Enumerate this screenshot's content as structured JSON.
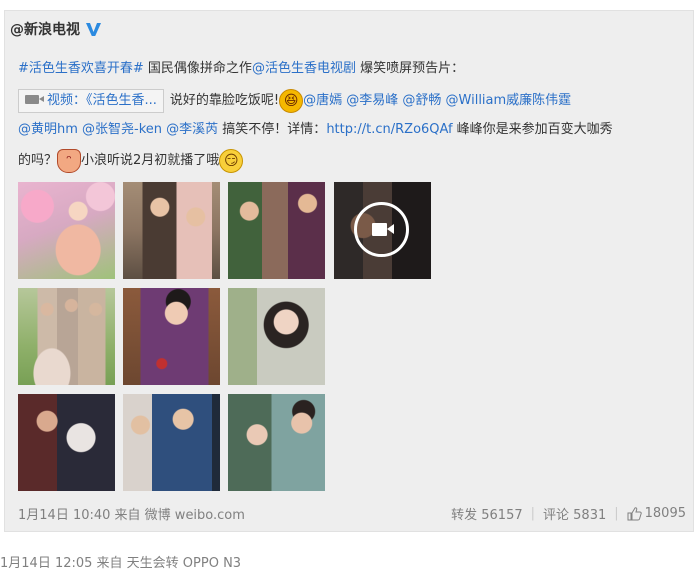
{
  "post": {
    "author": "@新浪电视",
    "verified_icon": "verified-v-icon",
    "hashtag": "#活色生香欢喜开春#",
    "text1": " 国民偶像拼命之作",
    "mention_show": "@活色生香电视剧",
    "text2": " 爆笑喷屏预告片：",
    "video_label": "视频：《活色生香...",
    "text3": "说好的靠脸吃饭呢!",
    "mentions_line2": "@唐嫣 @李易峰 @舒畅 @William威廉陈伟霆",
    "mentions_line3": "@黄明hm @张智尧-ken @李溪芮",
    "text4": " 搞笑不停！详情：",
    "link": "http://t.cn/RZo6QAf",
    "text5": " 峰峰你是来参加百变大咖秀",
    "text6": "的吗？",
    "text7": "小浪听说2月初就播了哦",
    "emoticons": [
      "laughing-face-icon",
      "elf-face-icon",
      "smirk-face-icon"
    ]
  },
  "thumbnails": [
    {
      "name": "photo-girl-blossoms"
    },
    {
      "name": "photo-two-actors"
    },
    {
      "name": "photo-couple-talking"
    },
    {
      "name": "video-thumbnail",
      "icon": "video-play-icon"
    },
    {
      "name": "photo-group-field"
    },
    {
      "name": "photo-woman-purple"
    },
    {
      "name": "photo-smiling-girl"
    },
    {
      "name": "photo-elderly-costume"
    },
    {
      "name": "photo-man-blue-coat"
    },
    {
      "name": "photo-two-women"
    }
  ],
  "meta": {
    "time_source": "1月14日 10:40 来自 微博 weibo.com"
  },
  "actions": {
    "repost_label": "转发",
    "repost_count": "56157",
    "comment_label": "评论",
    "comment_count": "5831",
    "like_icon": "thumbs-up-icon",
    "like_count": "18095"
  },
  "footer": {
    "time_source": "1月14日 12:05 来自 天生会转 OPPO N3"
  },
  "colors": {
    "link": "#2b70c8",
    "card_bg": "#eeeeee",
    "verified": "#2b8ae0",
    "meta": "#808080"
  }
}
